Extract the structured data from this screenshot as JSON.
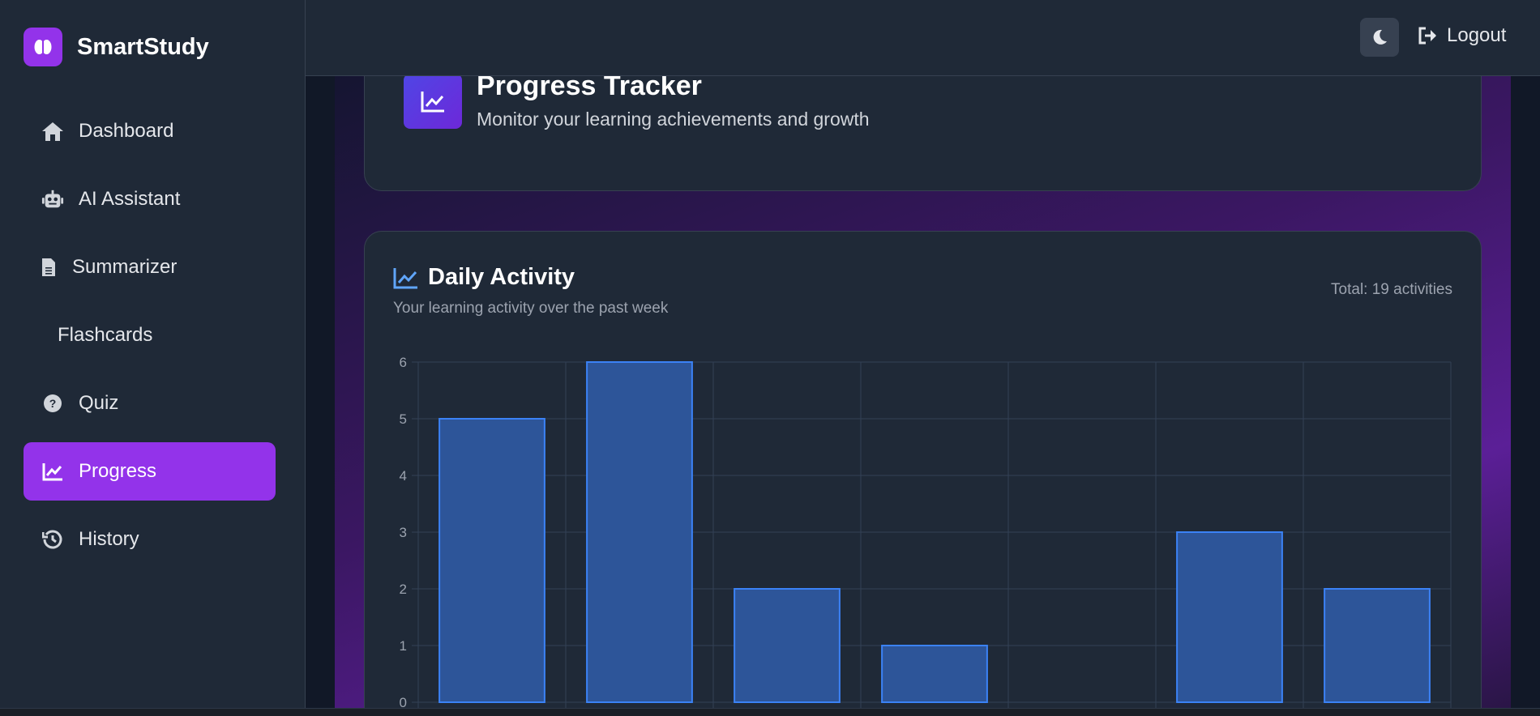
{
  "app": {
    "name": "SmartStudy"
  },
  "sidebar": {
    "items": [
      {
        "label": "Dashboard",
        "icon": "home-icon"
      },
      {
        "label": "AI Assistant",
        "icon": "robot-icon"
      },
      {
        "label": "Summarizer",
        "icon": "file-icon"
      },
      {
        "label": "Flashcards",
        "icon": ""
      },
      {
        "label": "Quiz",
        "icon": "question-circle-icon"
      },
      {
        "label": "Progress",
        "icon": "chart-line-icon",
        "active": true
      },
      {
        "label": "History",
        "icon": "history-icon"
      }
    ]
  },
  "topbar": {
    "logout_label": "Logout",
    "theme_icon": "moon-icon"
  },
  "header": {
    "title": "Progress Tracker",
    "subtitle": "Monitor your learning achievements and growth"
  },
  "activity": {
    "title": "Daily Activity",
    "subtitle": "Your learning activity over the past week",
    "total": "Total: 19 activities"
  },
  "colors": {
    "accent": "#9333ea",
    "bar_fill": "#2d5599",
    "bar_stroke": "#3b82f6",
    "card": "#1f2937"
  },
  "chart_data": {
    "type": "bar",
    "categories": [
      "",
      "",
      "",
      "",
      "",
      "",
      ""
    ],
    "values": [
      5,
      6,
      2,
      1,
      0,
      3,
      2
    ],
    "ylim": [
      0,
      6
    ],
    "yticks": [
      "0",
      "1",
      "2",
      "3",
      "4",
      "5",
      "6"
    ],
    "grid": true,
    "title": "",
    "xlabel": "",
    "ylabel": ""
  }
}
